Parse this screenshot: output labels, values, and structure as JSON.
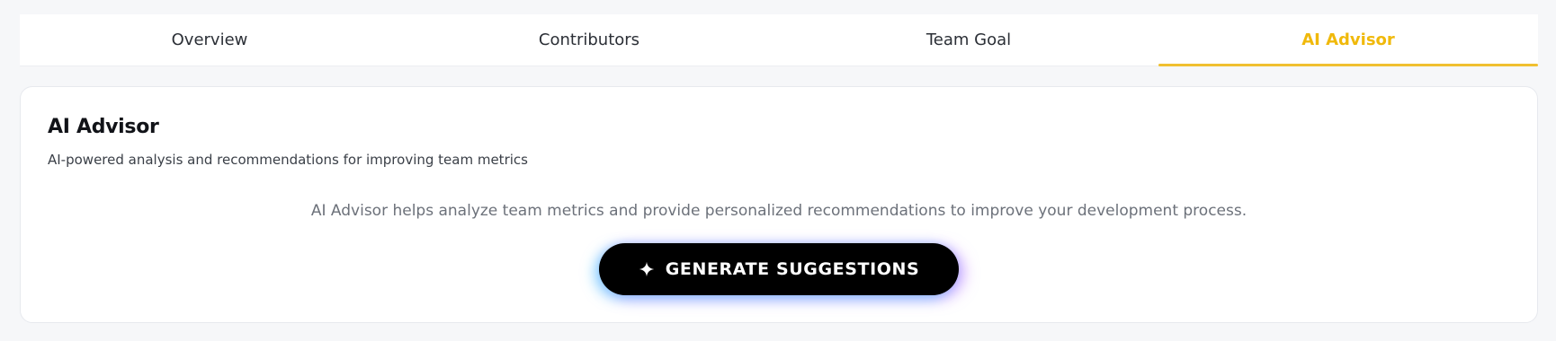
{
  "tabs": [
    {
      "label": "Overview",
      "active": false
    },
    {
      "label": "Contributors",
      "active": false
    },
    {
      "label": "Team Goal",
      "active": false
    },
    {
      "label": "AI Advisor",
      "active": true
    }
  ],
  "card": {
    "title": "AI Advisor",
    "subtitle": "AI-powered analysis and recommendations for improving team metrics",
    "description": "AI Advisor helps analyze team metrics and provide personalized recommendations to improve your development process.",
    "button_label": "GENERATE SUGGESTIONS",
    "button_icon": "sparkle-icon"
  },
  "colors": {
    "accent": "#f0b90b",
    "button_bg": "#000000",
    "glow_left": "#50c8ff",
    "glow_right": "#b46eff"
  }
}
